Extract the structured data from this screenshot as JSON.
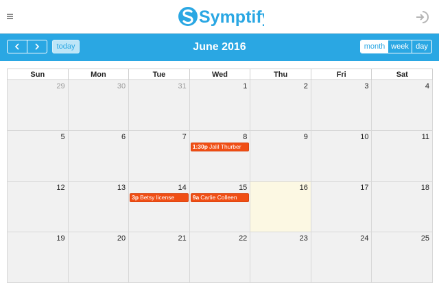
{
  "app": {
    "brand": "Symptify"
  },
  "colors": {
    "primary": "#2aa7e3",
    "event": "#f04e14",
    "today_bg": "#fcf8e3",
    "day_bg": "#f1f1f1"
  },
  "header": {
    "menu_icon": "hamburger-icon",
    "logout_icon": "logout-icon"
  },
  "toolbar": {
    "prev_icon": "chevron-left-icon",
    "next_icon": "chevron-right-icon",
    "today_label": "today",
    "title": "June 2016",
    "views": [
      {
        "label": "month",
        "active": true
      },
      {
        "label": "week",
        "active": false
      },
      {
        "label": "day",
        "active": false
      }
    ]
  },
  "calendar": {
    "days_of_week": [
      "Sun",
      "Mon",
      "Tue",
      "Wed",
      "Thu",
      "Fri",
      "Sat"
    ],
    "weeks": [
      [
        "29",
        "30",
        "31",
        "1",
        "2",
        "3",
        "4"
      ],
      [
        "5",
        "6",
        "7",
        "8",
        "9",
        "10",
        "11"
      ],
      [
        "12",
        "13",
        "14",
        "15",
        "16",
        "17",
        "18"
      ],
      [
        "19",
        "20",
        "21",
        "22",
        "23",
        "24",
        "25"
      ]
    ],
    "events": [
      {
        "time": "1:30p",
        "title": "Jalil Thurber"
      },
      {
        "time": "3p",
        "title": "Betsy license"
      },
      {
        "time": "9a",
        "title": "Carlie Colleen"
      }
    ]
  }
}
